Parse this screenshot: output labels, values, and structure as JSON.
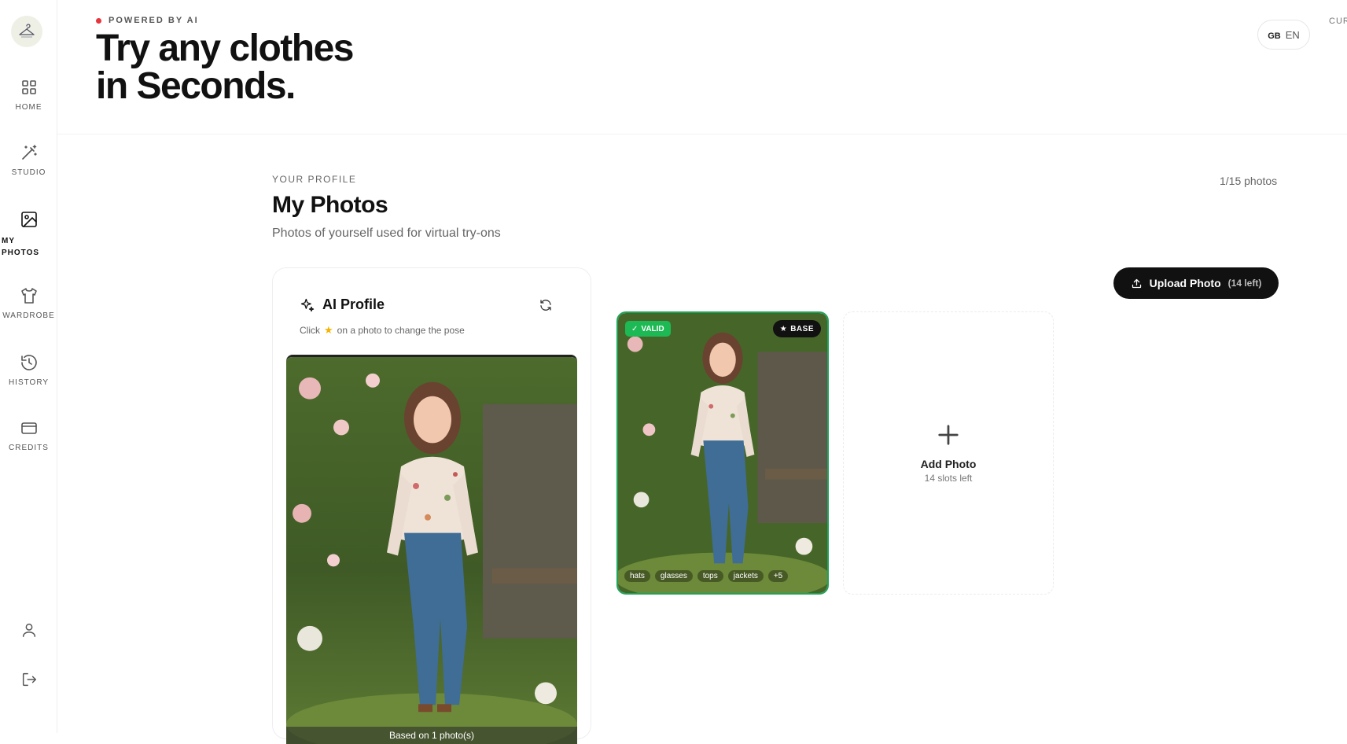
{
  "sidebar": {
    "items": [
      {
        "label": "HOME",
        "icon": "grid-icon"
      },
      {
        "label": "STUDIO",
        "icon": "magic-wand-icon"
      },
      {
        "label": "MY\nPHOTOS",
        "icon": "image-icon"
      },
      {
        "label": "WARDROBE",
        "icon": "shirt-icon"
      },
      {
        "label": "HISTORY",
        "icon": "history-icon"
      },
      {
        "label": "CREDITS",
        "icon": "credit-card-icon"
      }
    ],
    "active": "MY PHOTOS"
  },
  "hero": {
    "eyebrow": "POWERED BY AI",
    "title_line1": "Try any clothes",
    "title_line2": "in Seconds."
  },
  "header": {
    "lang_flag": "GB",
    "lang_code": "EN",
    "currency_label": "CUR"
  },
  "profile": {
    "eyebrow": "YOUR PROFILE",
    "title": "My Photos",
    "subtitle": "Photos of yourself used for virtual try-ons",
    "photo_count": "1/15 photos",
    "upload_label": "Upload Photo",
    "upload_left": "(14 left)"
  },
  "ai_profile": {
    "title": "AI Profile",
    "hint_prefix": "Click",
    "hint_suffix": "on a photo to change the pose",
    "based_on": "Based on 1 photo(s)"
  },
  "photo": {
    "valid_label": "VALID",
    "base_label": "BASE",
    "tags": [
      "hats",
      "glasses",
      "tops",
      "jackets",
      "+5"
    ]
  },
  "add_photo": {
    "title": "Add Photo",
    "subtitle": "14 slots left"
  },
  "colors": {
    "accent_dark": "#111111",
    "valid_green": "#1db954",
    "powered_dot": "#e8343c"
  }
}
